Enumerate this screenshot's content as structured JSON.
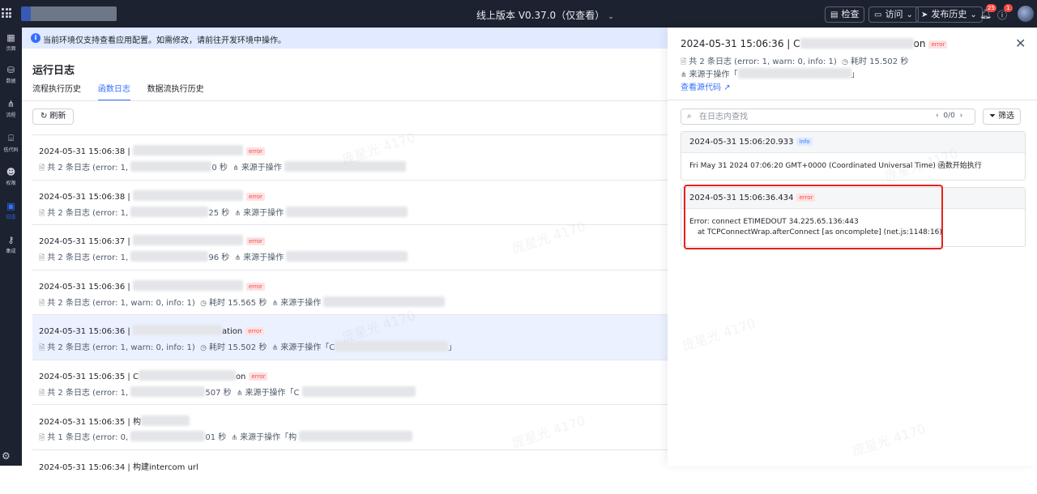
{
  "topbar": {
    "version_label": "线上版本 V0.37.0（仅查看）",
    "inspect_label": "检查",
    "visit_label": "访问",
    "publish_label": "发布历史",
    "bell_count": "25",
    "help_count": "1"
  },
  "sidebar": {
    "items": [
      {
        "label": "页面"
      },
      {
        "label": "数据"
      },
      {
        "label": "流程"
      },
      {
        "label": "低代码"
      },
      {
        "label": "权限"
      },
      {
        "label": "日志"
      },
      {
        "label": "集成"
      }
    ]
  },
  "notice": {
    "text": "当前环境仅支持查看应用配置。如需修改，请前往开发环境中操作。"
  },
  "main": {
    "title": "运行日志",
    "tabs": [
      {
        "label": "流程执行历史"
      },
      {
        "label": "函数日志"
      },
      {
        "label": "数据流执行历史"
      }
    ],
    "refresh_label": "刷新",
    "rows": [
      {
        "time": "2024-05-31 15:06:38",
        "name_prefix": "",
        "name_suffix": "",
        "tag": "error",
        "summary": "共 2 条日志 (error: 1,",
        "duration": "0 秒",
        "source_label": "来源于操作"
      },
      {
        "time": "2024-05-31 15:06:38",
        "name_prefix": "",
        "name_suffix": "",
        "tag": "error",
        "summary": "共 2 条日志 (error: 1,",
        "duration": "25 秒",
        "source_label": "来源于操作"
      },
      {
        "time": "2024-05-31 15:06:37",
        "name_prefix": "",
        "name_suffix": "",
        "tag": "error",
        "summary": "共 2 条日志 (error: 1,",
        "duration": "96 秒",
        "source_label": "来源于操作"
      },
      {
        "time": "2024-05-31 15:06:36",
        "name_prefix": "",
        "name_suffix": "",
        "tag": "error",
        "summary": "共 2 条日志 (error: 1, warn: 0, info: 1)",
        "duration": "耗时 15.565 秒",
        "source_label": "来源于操作"
      },
      {
        "time": "2024-05-31 15:06:36",
        "name_prefix": "",
        "name_suffix": "ation",
        "tag": "error",
        "summary": "共 2 条日志 (error: 1, warn: 0, info: 1)",
        "duration": "耗时 15.502 秒",
        "source_label": "来源于操作「C",
        "source_end": "」"
      },
      {
        "time": "2024-05-31 15:06:35",
        "name_prefix": "C",
        "name_suffix": "on",
        "tag": "error",
        "summary": "共 2 条日志 (error: 1,",
        "duration": "507 秒",
        "source_label": "来源于操作「C"
      },
      {
        "time": "2024-05-31 15:06:35",
        "name_prefix": "构",
        "name_suffix": "",
        "tag": "",
        "summary": "共 1 条日志 (error: 0,",
        "duration": "01 秒",
        "source_label": "来源于操作「构"
      },
      {
        "time": "2024-05-31 15:06:34",
        "name_prefix": "构建intercom url",
        "name_suffix": "",
        "tag": "",
        "summary": "",
        "duration": "",
        "source_label": ""
      }
    ]
  },
  "drawer": {
    "title_time": "2024-05-31 15:06:36",
    "title_prefix": "C",
    "title_suffix": "on",
    "title_tag": "error",
    "summary": "共 2 条日志 (error: 1, warn: 0, info: 1)",
    "duration": "耗时 15.502 秒",
    "source_label": "来源于操作「",
    "source_end": "」",
    "view_source_label": "查看源代码",
    "search_placeholder": "在日志内查找",
    "pager": "0/0",
    "filter_label": "筛选",
    "logs": [
      {
        "time": "2024-05-31 15:06:20.933",
        "level": "info",
        "lines": [
          "Fri May 31 2024 07:06:20 GMT+0000 (Coordinated Universal Time) 函数开始执行"
        ]
      },
      {
        "time": "2024-05-31 15:06:36.434",
        "level": "error",
        "lines": [
          "Error: connect ETIMEDOUT 34.225.65.136:443",
          "at TCPConnectWrap.afterConnect [as oncomplete] (net.js:1148:16)"
        ]
      }
    ]
  },
  "watermark": "庞星光 4170"
}
